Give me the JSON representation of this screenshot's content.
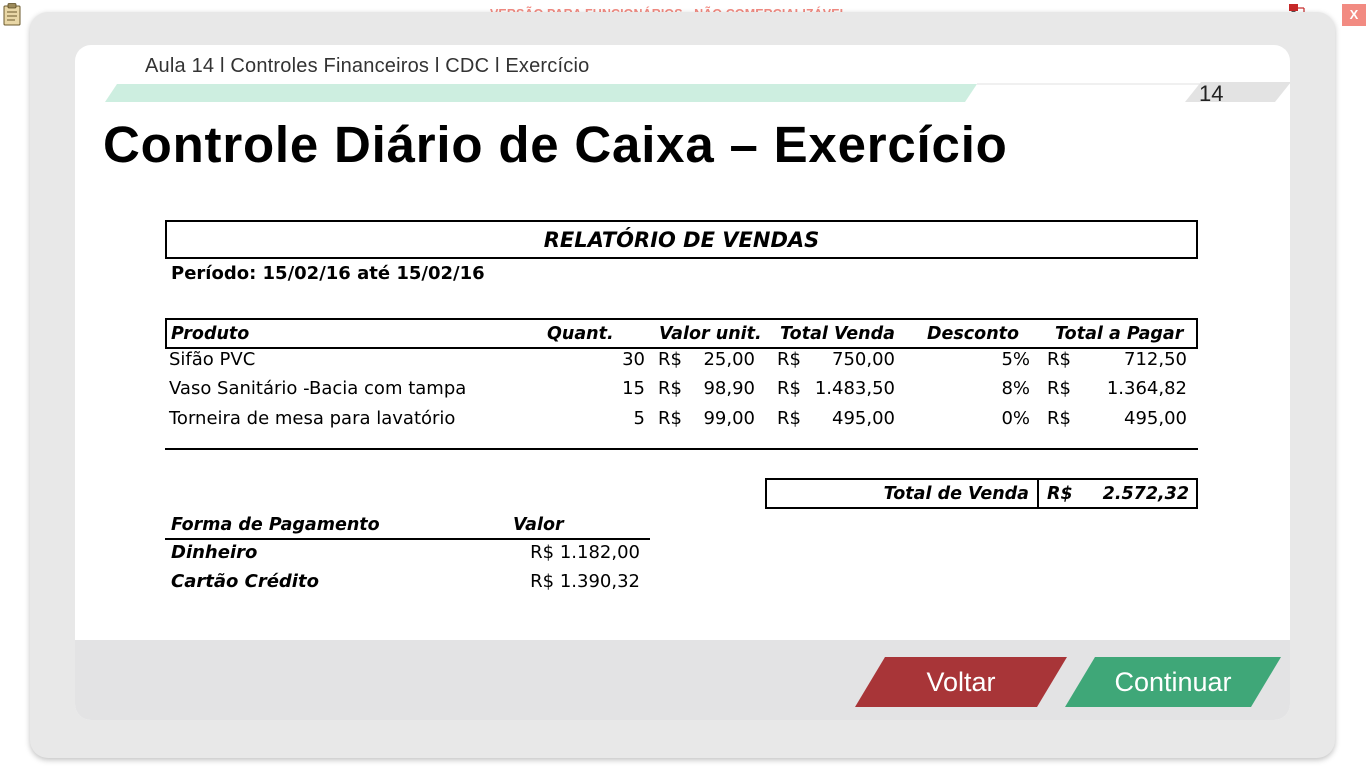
{
  "watermark": "VERSÃO PARA FUNCIONÁRIOS - NÃO COMERCIALIZÁVEL",
  "close_label": "X",
  "breadcrumb": "Aula 14 l Controles Financeiros l CDC l Exercício",
  "page_number": "14",
  "title": "Controle Diário de Caixa – Exercício",
  "report": {
    "title": "RELATÓRIO DE VENDAS",
    "period": "Período: 15/02/16 até 15/02/16",
    "headers": {
      "produto": "Produto",
      "quant": "Quant.",
      "valor_unit": "Valor unit.",
      "total_venda": "Total Venda",
      "desconto": "Desconto",
      "total_pagar": "Total a Pagar"
    },
    "rows": [
      {
        "produto": "Sifão PVC",
        "quant": "30",
        "cur1": "R$",
        "valor_unit": "25,00",
        "cur2": "R$",
        "total_venda": "750,00",
        "desconto": "5%",
        "cur3": "R$",
        "total_pagar": "712,50"
      },
      {
        "produto": "Vaso Sanitário -Bacia com tampa",
        "quant": "15",
        "cur1": "R$",
        "valor_unit": "98,90",
        "cur2": "R$",
        "total_venda": "1.483,50",
        "desconto": "8%",
        "cur3": "R$",
        "total_pagar": "1.364,82"
      },
      {
        "produto": "Torneira de mesa para lavatório",
        "quant": "5",
        "cur1": "R$",
        "valor_unit": "99,00",
        "cur2": "R$",
        "total_venda": "495,00",
        "desconto": "0%",
        "cur3": "R$",
        "total_pagar": "495,00"
      }
    ],
    "total_venda": {
      "label": "Total de Venda",
      "currency": "R$",
      "value": "2.572,32"
    },
    "payment": {
      "header_forma": "Forma de Pagamento",
      "header_valor": "Valor",
      "rows": [
        {
          "label": "Dinheiro",
          "value": "R$  1.182,00"
        },
        {
          "label": "Cartão Crédito",
          "value": "R$  1.390,32"
        }
      ]
    }
  },
  "buttons": {
    "voltar": "Voltar",
    "continuar": "Continuar"
  },
  "colors": {
    "voltar": "#a83538",
    "continuar": "#3fa778",
    "watermark": "#f28b82",
    "header_strip": "#cdeee0"
  }
}
